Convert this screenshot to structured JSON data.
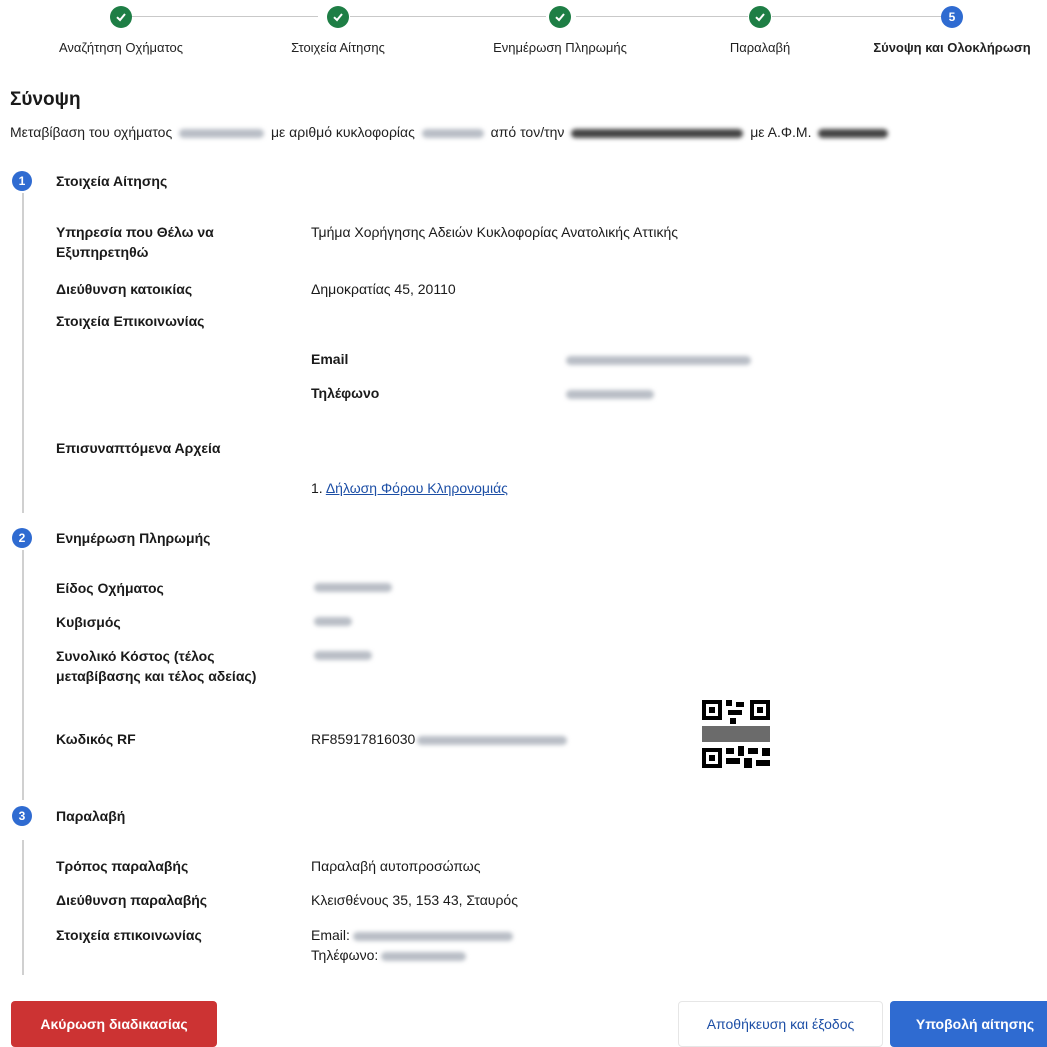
{
  "stepper": {
    "steps": [
      {
        "label": "Αναζήτηση Οχήματος",
        "state": "done",
        "icon": "check-icon"
      },
      {
        "label": "Στοιχεία Αίτησης",
        "state": "done",
        "icon": "check-icon"
      },
      {
        "label": "Ενημέρωση Πληρωμής",
        "state": "done",
        "icon": "check-icon"
      },
      {
        "label": "Παραλαβή",
        "state": "done",
        "icon": "check-icon"
      },
      {
        "label": "Σύνοψη και Ολοκλήρωση",
        "state": "current",
        "number": "5"
      }
    ]
  },
  "summary": {
    "title": "Σύνοψη",
    "intro_1": "Μεταβίβαση του οχήματος",
    "intro_2": "με αριθμό κυκλοφορίας",
    "intro_3": "από τον/την",
    "intro_4": "με Α.Φ.Μ."
  },
  "section1": {
    "number": "1",
    "title": "Στοιχεία Αίτησης",
    "service_label": "Υπηρεσία που Θέλω να Εξυπηρετηθώ",
    "service_value": "Τμήμα Χορήγησης Αδειών Κυκλοφορίας Ανατολικής Αττικής",
    "address_label": "Διεύθυνση κατοικίας",
    "address_value": "Δημοκρατίας 45, 20110",
    "contact_label": "Στοιχεία Επικοινωνίας",
    "email_label": "Email",
    "phone_label": "Τηλέφωνο",
    "files_label": "Επισυναπτόμενα Αρχεία",
    "file_index": "1.",
    "file_link": "Δήλωση Φόρου Κληρονομιάς"
  },
  "section2": {
    "number": "2",
    "title": "Ενημέρωση Πληρωμής",
    "vehicle_type_label": "Είδος Οχήματος",
    "displacement_label": "Κυβισμός",
    "total_cost_label": "Συνολικό Κόστος (τέλος μεταβίβασης και τέλος αδείας)",
    "rf_label": "Κωδικός RF",
    "rf_value": "RF85917816030"
  },
  "section3": {
    "number": "3",
    "title": "Παραλαβή",
    "method_label": "Τρόπος παραλαβής",
    "method_value": "Παραλαβή αυτοπροσώπως",
    "pickup_address_label": "Διεύθυνση παραλαβής",
    "pickup_address_value": "Κλεισθένους 35, 153 43, Σταυρός",
    "contact_label": "Στοιχεία επικοινωνίας",
    "contact_email_prefix": "Email:",
    "contact_phone_prefix": "Τηλέφωνο:"
  },
  "buttons": {
    "cancel": "Ακύρωση διαδικασίας",
    "save_exit": "Αποθήκευση και έξοδος",
    "submit": "Υποβολή αίτησης"
  },
  "colors": {
    "step_done": "#1e7e45",
    "accent": "#2f6bd1",
    "danger": "#cc3333",
    "link": "#1d4fa6"
  }
}
